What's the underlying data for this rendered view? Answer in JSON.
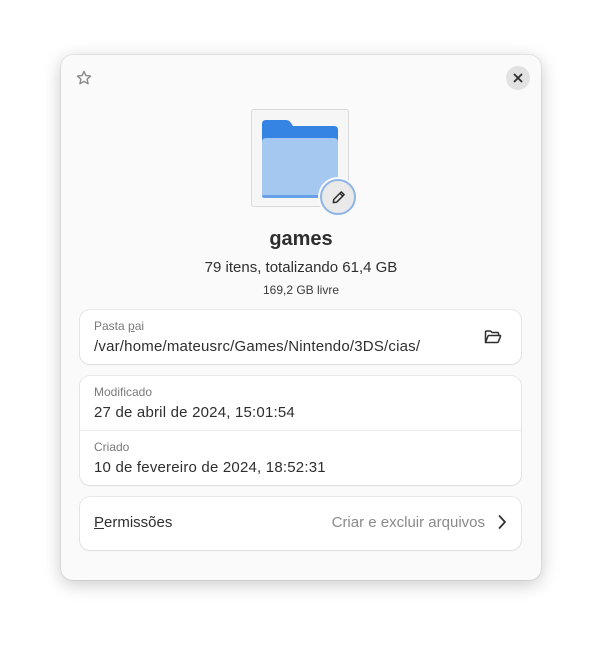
{
  "header": {
    "star_icon": "star-outline-icon",
    "close_icon": "close-icon"
  },
  "folder": {
    "name": "games",
    "summary": "79 itens, totalizando 61,4 GB",
    "free_space": "169,2 GB livre",
    "icon": "folder-icon",
    "folder_color": "#3584e4",
    "folder_front_color": "#a4c8f0",
    "edit_icon": "pencil-icon"
  },
  "parent_folder": {
    "label_prefix": "Pasta ",
    "label_mnemonic": "p",
    "label_suffix": "ai",
    "path": "/var/home/mateusrc/Games/Nintendo/3DS/cias/",
    "open_icon": "folder-open-icon"
  },
  "dates": {
    "modified_label": "Modificado",
    "modified_value": "27 de abril de 2024, 15:01:54",
    "created_label": "Criado",
    "created_value": "10 de fevereiro de 2024, 18:52:31"
  },
  "permissions": {
    "label_mnemonic": "P",
    "label_rest": "ermissões",
    "value": "Criar e excluir arquivos",
    "chevron_icon": "chevron-right-icon"
  }
}
